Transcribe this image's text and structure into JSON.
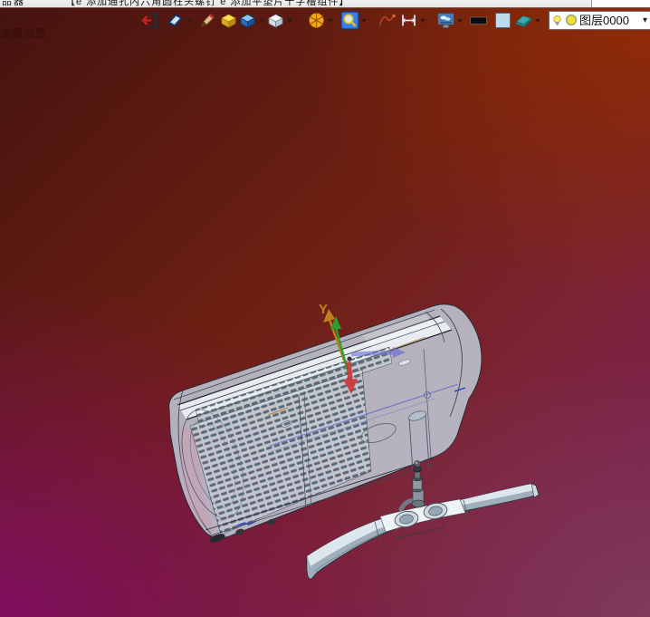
{
  "menubar": {
    "left_fragment": "品器",
    "title_fragment": "【e 添加通孔内六角圆柱头螺钉 e 添加平垫片十字槽组件】"
  },
  "toolbar": {
    "icons": [
      {
        "name": "exit-icon",
        "dropdown": false
      },
      {
        "name": "notebook-icon",
        "dropdown": true
      },
      {
        "name": "pencil-icon",
        "dropdown": false
      },
      {
        "name": "yellow-box-icon",
        "dropdown": false
      },
      {
        "name": "blue-cube-icon",
        "dropdown": true
      },
      {
        "name": "white-cube-icon",
        "dropdown": true
      },
      {
        "name": "orange-wheel-icon",
        "dropdown": true
      },
      {
        "name": "magnifier-icon",
        "dropdown": true
      },
      {
        "name": "spline-icon",
        "dropdown": false
      },
      {
        "name": "measure-icon",
        "dropdown": true
      },
      {
        "name": "scene-monitor-icon",
        "dropdown": true
      },
      {
        "name": "black-bar-icon",
        "dropdown": false
      },
      {
        "name": "blue-square-icon",
        "dropdown": false
      },
      {
        "name": "eraser-icon",
        "dropdown": true
      }
    ],
    "layer_combo": {
      "value": "图层0000"
    }
  },
  "viewport": {
    "filter_label": "滤器设置",
    "axis_y_label": "Y"
  },
  "colors": {
    "bg_top_left": "#471410",
    "bg_top_right": "#8d2a06",
    "bg_bottom_left": "#7d1061",
    "bg_bottom_right": "#7a3a55",
    "model_body": "#c3d2db",
    "axis_y_orange": "#c08020",
    "axis_green": "#2f9e2f",
    "axis_red": "#cc3636",
    "axis_blue": "#7d7dd2"
  }
}
